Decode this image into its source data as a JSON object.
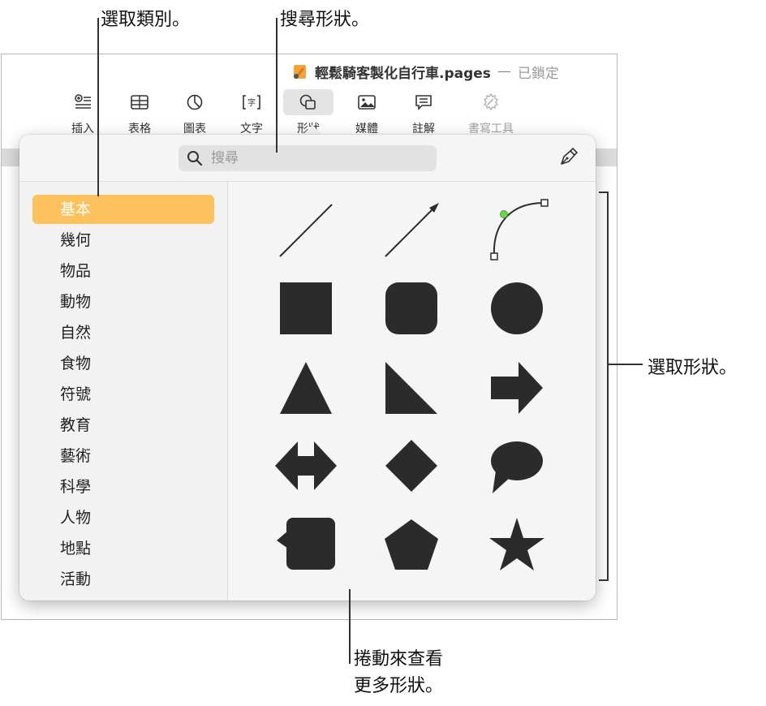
{
  "window": {
    "document_name": "輕鬆騎客製化自行車.pages",
    "separator": "—",
    "lock_status": "已鎖定"
  },
  "toolbar": {
    "items": [
      {
        "label": "插入",
        "icon": "insert-icon"
      },
      {
        "label": "表格",
        "icon": "table-icon"
      },
      {
        "label": "圖表",
        "icon": "chart-icon"
      },
      {
        "label": "文字",
        "icon": "text-icon"
      },
      {
        "label": "形狀",
        "icon": "shape-icon",
        "selected": true
      },
      {
        "label": "媒體",
        "icon": "media-icon"
      },
      {
        "label": "註解",
        "icon": "comment-icon"
      },
      {
        "label": "書寫工具",
        "icon": "writing-tools-icon",
        "disabled": true
      }
    ]
  },
  "shapes_popover": {
    "search": {
      "placeholder": "搜尋",
      "value": ""
    },
    "pen_tool_icon": "pen-icon",
    "categories": [
      "基本",
      "幾何",
      "物品",
      "動物",
      "自然",
      "食物",
      "符號",
      "教育",
      "藝術",
      "科學",
      "人物",
      "地點",
      "活動"
    ],
    "selected_category": "基本",
    "shapes": [
      "line",
      "arrow-line",
      "curve",
      "square",
      "rounded-square",
      "circle",
      "triangle",
      "right-triangle",
      "arrow",
      "double-arrow",
      "diamond",
      "speech-bubble",
      "callout-square",
      "pentagon",
      "star"
    ],
    "shape_color": "#2b2b2b",
    "accent_color": "#fcc25d",
    "curve_handle_color": "#6fd24a"
  },
  "callouts": {
    "choose_category": "選取類別。",
    "search_shapes": "搜尋形狀。",
    "choose_shape": "選取形狀。",
    "scroll_more_line1": "捲動來查看",
    "scroll_more_line2": "更多形狀。"
  }
}
